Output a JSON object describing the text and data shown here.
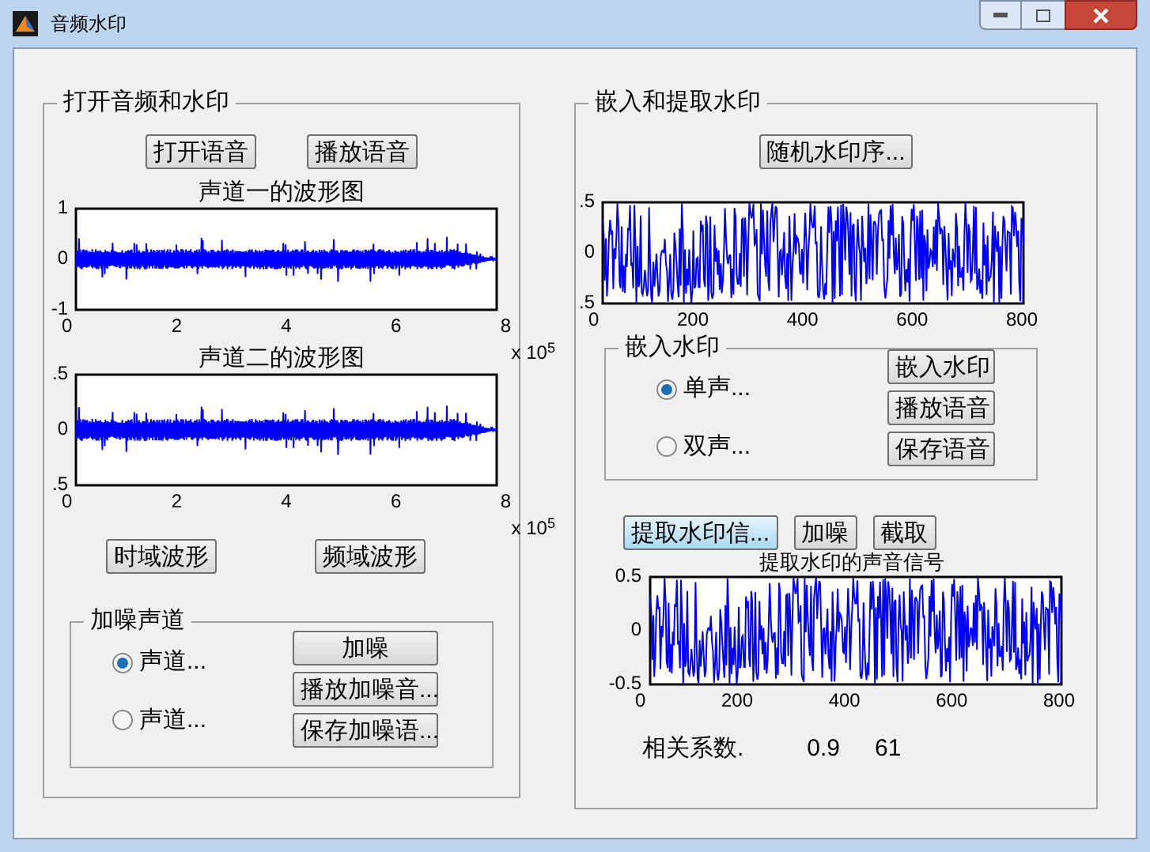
{
  "window": {
    "title": "音频水印"
  },
  "left_panel": {
    "title": "打开音频和水印",
    "buttons": [
      "打开语音",
      "播放语音"
    ],
    "plots": [
      {
        "kind": "audio",
        "title": "声道一的波形图",
        "yticks": [
          "1",
          "0",
          "-1"
        ],
        "xticks": [
          "0",
          "2",
          "4",
          "6",
          "8"
        ],
        "exponent": "x 10$^{5}$"
      },
      {
        "kind": "audio",
        "title": "声道二的波形图",
        "yticks": [
          ".5",
          "0",
          ".5"
        ],
        "xticks": [
          "0",
          "2",
          "4",
          "6",
          "8"
        ],
        "exponent": "x 10$^{5}$"
      }
    ],
    "view_buttons": [
      "时域波形",
      "频域波形"
    ],
    "noise_group": {
      "title": "加噪声道",
      "options": [
        {
          "label": "声道...",
          "selected": true
        },
        {
          "label": "声道...",
          "selected": false
        }
      ],
      "buttons": [
        "加噪",
        "播放加噪音...",
        "保存加噪语..."
      ]
    }
  },
  "right_panel": {
    "title": "嵌入和提取水印",
    "random_button": "随机水印序...",
    "watermark_plot": {
      "kind": "noise",
      "yticks": [
        ".5",
        "0",
        ".5"
      ],
      "xticks": [
        "0",
        "200",
        "400",
        "600",
        "800"
      ]
    },
    "embed_group": {
      "title": "嵌入水印",
      "options": [
        {
          "label": "单声...",
          "selected": true
        },
        {
          "label": "双声...",
          "selected": false
        }
      ],
      "buttons": [
        "嵌入水印",
        "播放语音",
        "保存语音"
      ]
    },
    "action_buttons": [
      {
        "label": "提取水印信...",
        "focused": true
      },
      {
        "label": "加噪",
        "focused": false
      },
      {
        "label": "截取",
        "focused": false
      }
    ],
    "extract_plot": {
      "kind": "noise",
      "title": "提取水印的声音信号",
      "yticks": [
        "0.5",
        "0",
        "-0.5"
      ],
      "xticks": [
        "0",
        "200",
        "400",
        "600",
        "800"
      ]
    },
    "correlation": {
      "label": "相关系数.",
      "value_start": "0.9",
      "value_end": "61"
    }
  }
}
